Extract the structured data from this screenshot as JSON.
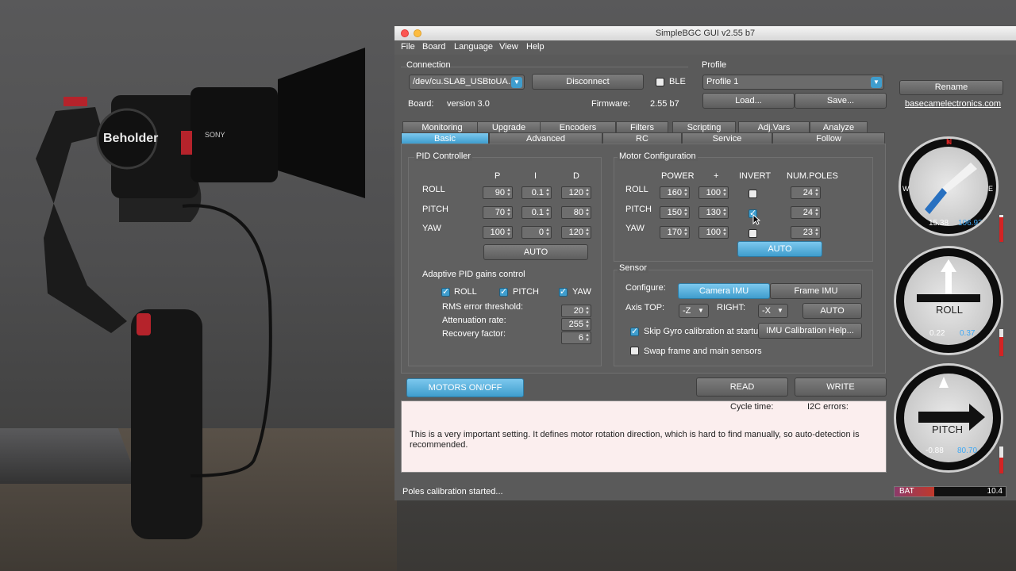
{
  "window": {
    "title": "SimpleBGC GUI v2.55 b7"
  },
  "menu": [
    "File",
    "Board",
    "Language",
    "View",
    "Help"
  ],
  "connection": {
    "heading": "Connection",
    "port": "/dev/cu.SLAB_USBtoUA...",
    "disconnect_label": "Disconnect",
    "ble_label": "BLE",
    "board_label": "Board:",
    "board_version": "version 3.0",
    "firmware_label": "Firmware:",
    "firmware_version": "2.55 b7"
  },
  "profile": {
    "heading": "Profile",
    "selected": "Profile 1",
    "load_label": "Load...",
    "save_label": "Save...",
    "rename_label": "Rename",
    "link": "basecamelectronics.com"
  },
  "tabs_top": [
    "Monitoring",
    "Upgrade",
    "Encoders",
    "Filters",
    "Scripting",
    "Adj.Vars",
    "Analyze"
  ],
  "tabs_bottom": [
    "Basic",
    "Advanced",
    "RC",
    "Service",
    "Follow"
  ],
  "pid": {
    "heading": "PID Controller",
    "columns": [
      "P",
      "I",
      "D"
    ],
    "rows": [
      {
        "axis": "ROLL",
        "p": "90",
        "i": "0.1",
        "d": "120"
      },
      {
        "axis": "PITCH",
        "p": "70",
        "i": "0.1",
        "d": "80"
      },
      {
        "axis": "YAW",
        "p": "100",
        "i": "0",
        "d": "120"
      }
    ],
    "auto_label": "AUTO",
    "adaptive_heading": "Adaptive PID gains control",
    "adaptive_roll": "ROLL",
    "adaptive_pitch": "PITCH",
    "adaptive_yaw": "YAW",
    "rms_label": "RMS error threshold:",
    "rms_value": "20",
    "attenuation_label": "Attenuation rate:",
    "attenuation_value": "255",
    "recovery_label": "Recovery factor:",
    "recovery_value": "6"
  },
  "motor": {
    "heading": "Motor Configuration",
    "columns": [
      "POWER",
      "+",
      "INVERT",
      "NUM.POLES"
    ],
    "rows": [
      {
        "axis": "ROLL",
        "power": "160",
        "plus": "100",
        "invert": false,
        "poles": "24"
      },
      {
        "axis": "PITCH",
        "power": "150",
        "plus": "130",
        "invert": true,
        "poles": "24"
      },
      {
        "axis": "YAW",
        "power": "170",
        "plus": "100",
        "invert": false,
        "poles": "23"
      }
    ],
    "auto_label": "AUTO"
  },
  "sensor": {
    "heading": "Sensor",
    "configure_label": "Configure:",
    "camera_imu": "Camera IMU",
    "frame_imu": "Frame IMU",
    "axis_top_label": "Axis TOP:",
    "axis_top_value": "-Z",
    "right_label": "RIGHT:",
    "right_value": "-X",
    "auto_label": "AUTO",
    "skip_gyro_label": "Skip Gyro calibration at startu",
    "imu_help_label": "IMU Calibration Help...",
    "swap_label": "Swap frame and main sensors"
  },
  "actions": {
    "motors_label": "MOTORS ON/OFF",
    "read_label": "READ",
    "write_label": "WRITE"
  },
  "info": {
    "cycle_time_label": "Cycle time:",
    "i2c_label": "I2C errors:",
    "message": "This is a very important setting. It defines motor rotation direction, which is hard to find manually, so auto-detection is recommended."
  },
  "status": {
    "text": "Poles calibration started...",
    "bat_label": "BAT",
    "bat_value": "10.4"
  },
  "gauges": {
    "compass": {
      "n": "N",
      "e": "E",
      "w": "W",
      "left": "15.38",
      "right": "106.92"
    },
    "roll": {
      "label": "ROLL",
      "left": "0.22",
      "right": "0.37"
    },
    "pitch": {
      "label": "PITCH",
      "left": "-0.88",
      "right": "80.70"
    }
  },
  "photo": {
    "brand": "Beholder",
    "lens_brand": "SONY"
  },
  "colors": {
    "accent": "#3f9dcd",
    "window_bg": "#5a5a5a",
    "alert": "#d32323"
  }
}
